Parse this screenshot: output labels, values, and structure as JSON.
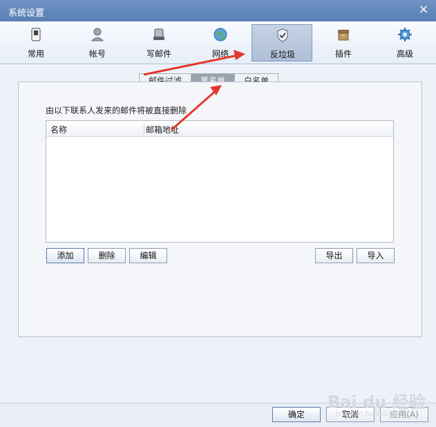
{
  "window": {
    "title": "系统设置",
    "close_label": "×"
  },
  "toolbar": {
    "items": [
      {
        "label": "常用",
        "icon": "phone-icon"
      },
      {
        "label": "帐号",
        "icon": "user-icon"
      },
      {
        "label": "写邮件",
        "icon": "compose-icon"
      },
      {
        "label": "网络",
        "icon": "globe-icon"
      },
      {
        "label": "反垃圾",
        "icon": "shield-icon"
      },
      {
        "label": "插件",
        "icon": "plugin-icon"
      },
      {
        "label": "高级",
        "icon": "gear-icon"
      }
    ]
  },
  "tabs": [
    {
      "label": "邮件过滤"
    },
    {
      "label": "黑名单"
    },
    {
      "label": "白名单"
    }
  ],
  "content": {
    "description": "由以下联系人发来的邮件将被直接删除",
    "columns": [
      "名称",
      "邮箱地址"
    ]
  },
  "actions": {
    "add": "添加",
    "delete": "删除",
    "edit": "编辑",
    "export": "导出",
    "import": "导入"
  },
  "footer": {
    "ok": "确定",
    "cancel": "取消",
    "apply": "应用(A)"
  },
  "watermark": {
    "text": "Bai du 经验",
    "subtext": "jingyan.baidu.com"
  }
}
